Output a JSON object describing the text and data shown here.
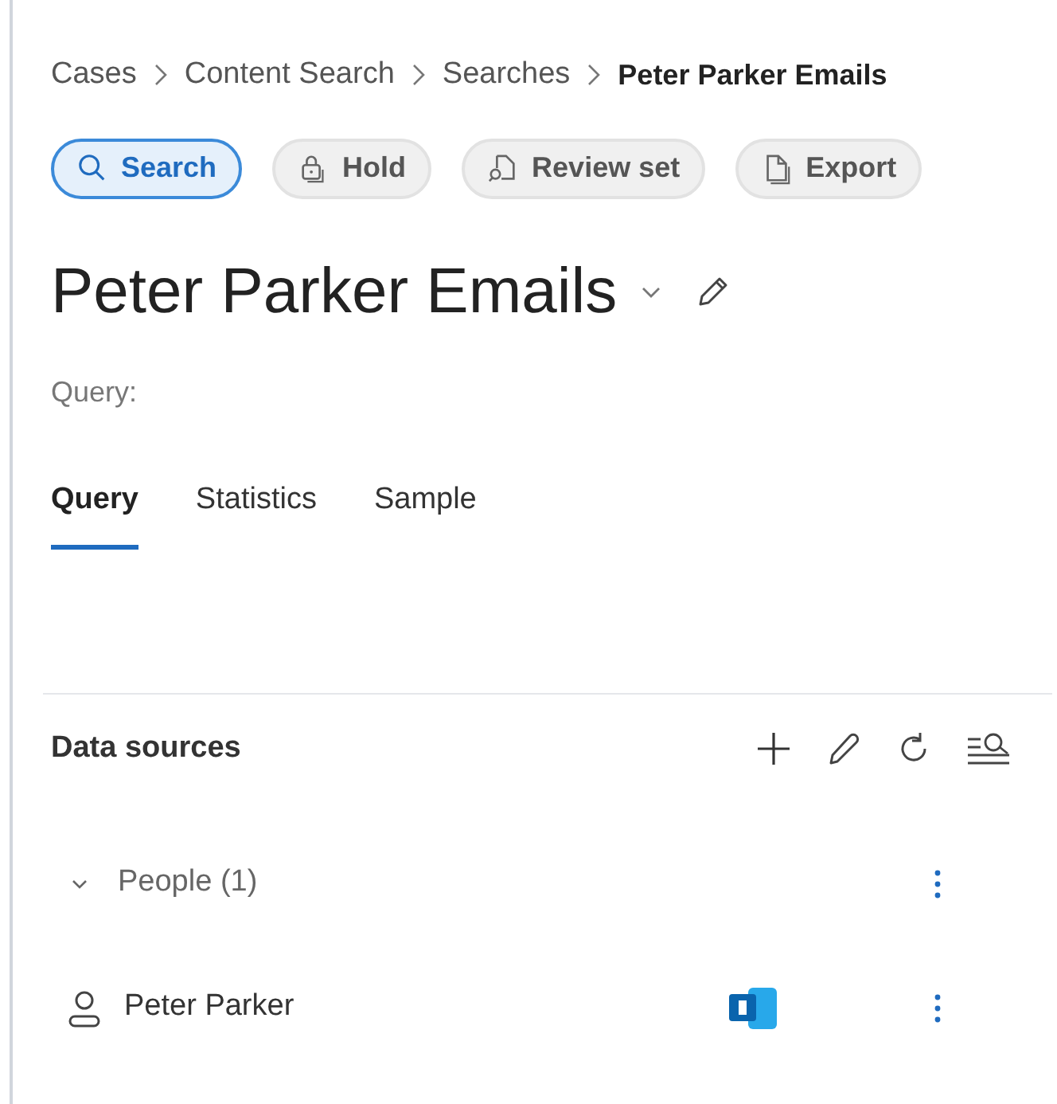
{
  "breadcrumb": [
    "Cases",
    "Content Search",
    "Searches",
    "Peter Parker Emails"
  ],
  "actions": [
    {
      "label": "Search",
      "kind": "search",
      "selected": true
    },
    {
      "label": "Hold",
      "kind": "lock",
      "selected": false
    },
    {
      "label": "Review set",
      "kind": "review",
      "selected": false
    },
    {
      "label": "Export",
      "kind": "doc",
      "selected": false
    }
  ],
  "title": "Peter Parker Emails",
  "query_label": "Query:",
  "tabs": [
    {
      "label": "Query",
      "selected": true
    },
    {
      "label": "Statistics",
      "selected": false
    },
    {
      "label": "Sample",
      "selected": false
    }
  ],
  "data_sources": {
    "title": "Data sources",
    "groups": [
      {
        "label": "People (1)",
        "expanded": true,
        "children": [
          {
            "name": "Peter Parker"
          }
        ]
      }
    ]
  }
}
